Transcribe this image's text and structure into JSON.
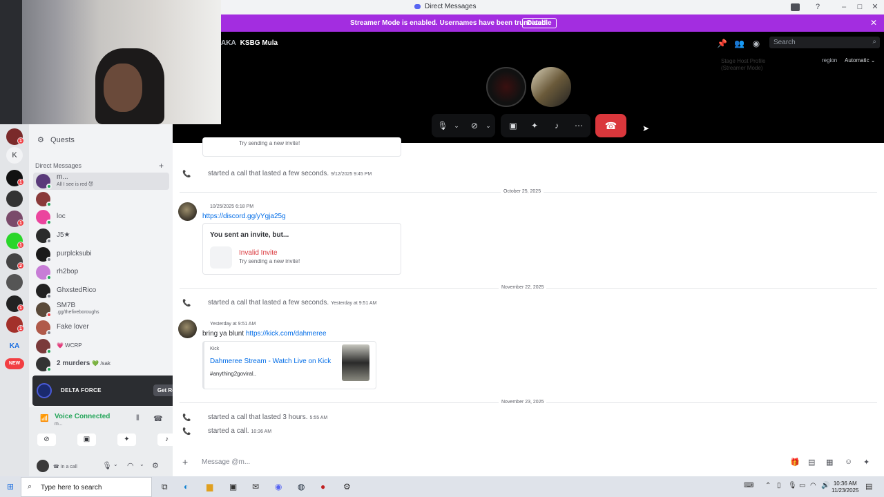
{
  "window": {
    "title": "Direct Messages"
  },
  "banner": {
    "text": "Streamer Mode is enabled. Usernames have been truncated.",
    "button": "Disable"
  },
  "call": {
    "header_prefix": "AKA",
    "header_name": "KSBG Mula",
    "search_placeholder": "Search",
    "region_label": "region",
    "region_value": "Automatic",
    "faint_lines": [
      "Stage Host Profile",
      "(Streamer Mode)"
    ]
  },
  "sidebar": {
    "quests": "Quests",
    "dm_header": "Direct Messages",
    "dms": [
      {
        "name": "m...",
        "sub": "All I see is red 😈",
        "color": "#5a3a7a",
        "status": "online"
      },
      {
        "name": "",
        "sub": "",
        "color": "#8a3a3a",
        "status": "online"
      },
      {
        "name": "loc",
        "sub": "",
        "color": "#eb459e",
        "status": "online"
      },
      {
        "name": "J5★",
        "sub": "",
        "color": "#2b2b2b",
        "status": "offline"
      },
      {
        "name": "purplcksubi",
        "sub": "",
        "color": "#1a1a1a",
        "status": "offline"
      },
      {
        "name": "rh2bop",
        "sub": "",
        "color": "#c77dd6",
        "status": "online"
      },
      {
        "name": "GhxstedRico",
        "sub": "",
        "color": "#222",
        "status": "offline"
      },
      {
        "name": "SM7B",
        "sub": ".gg/thefiveboroughs",
        "color": "#5a4a3a",
        "status": "dnd"
      },
      {
        "name": "Fake lover",
        "sub": "",
        "color": "#b05a4a",
        "status": "offline"
      },
      {
        "name": "",
        "sub": "",
        "color": "#7a3a3a",
        "status": "online",
        "badge": "💗 WCRP"
      },
      {
        "name": "2 murders",
        "sub": "",
        "color": "#333",
        "status": "online",
        "badge": "💚 /sak"
      }
    ]
  },
  "promo": {
    "title": "DELTA FORCE",
    "button": "Get Reward!"
  },
  "voice": {
    "status": "Voice Connected",
    "sub": "m..."
  },
  "user": {
    "status": "In a call"
  },
  "chat": {
    "truncated_invite_sub": "Try sending a new invite!",
    "items": [
      {
        "kind": "call",
        "text": "started a call that lasted a few seconds.",
        "ts": "9/12/2025 9:45 PM"
      },
      {
        "kind": "divider",
        "label": "October 25, 2025"
      },
      {
        "kind": "msg",
        "ts": "10/25/2025 6:18 PM",
        "link": "https://discord.gg/yYgja25g"
      },
      {
        "kind": "invite",
        "heading": "You sent an invite, but...",
        "title": "Invalid Invite",
        "sub": "Try sending a new invite!"
      },
      {
        "kind": "divider",
        "label": "November 22, 2025"
      },
      {
        "kind": "call",
        "text": "started a call that lasted a few seconds.",
        "ts": "Yesterday at 9:51 AM"
      },
      {
        "kind": "msg",
        "ts": "Yesterday at 9:51 AM",
        "prefix": "bring ya blunt",
        "link": "https://kick.com/dahmeree"
      },
      {
        "kind": "embed",
        "provider": "Kick",
        "title": "Dahmeree Stream - Watch Live on Kick",
        "desc": "#anything2goviral.."
      },
      {
        "kind": "divider",
        "label": "November 23, 2025"
      },
      {
        "kind": "call",
        "text": "started a call that lasted 3 hours.",
        "ts": "5:55 AM"
      },
      {
        "kind": "call",
        "text": "started a call.",
        "ts": "10:36 AM"
      }
    ]
  },
  "composer": {
    "placeholder": "Message @m..."
  },
  "taskbar": {
    "search": "Type here to search",
    "time": "10:36 AM",
    "date": "11/23/2025"
  },
  "colors": {
    "brand": "#5865f2",
    "streamer_banner": "#a32de0",
    "hangup": "#da373c",
    "online": "#23a559"
  }
}
